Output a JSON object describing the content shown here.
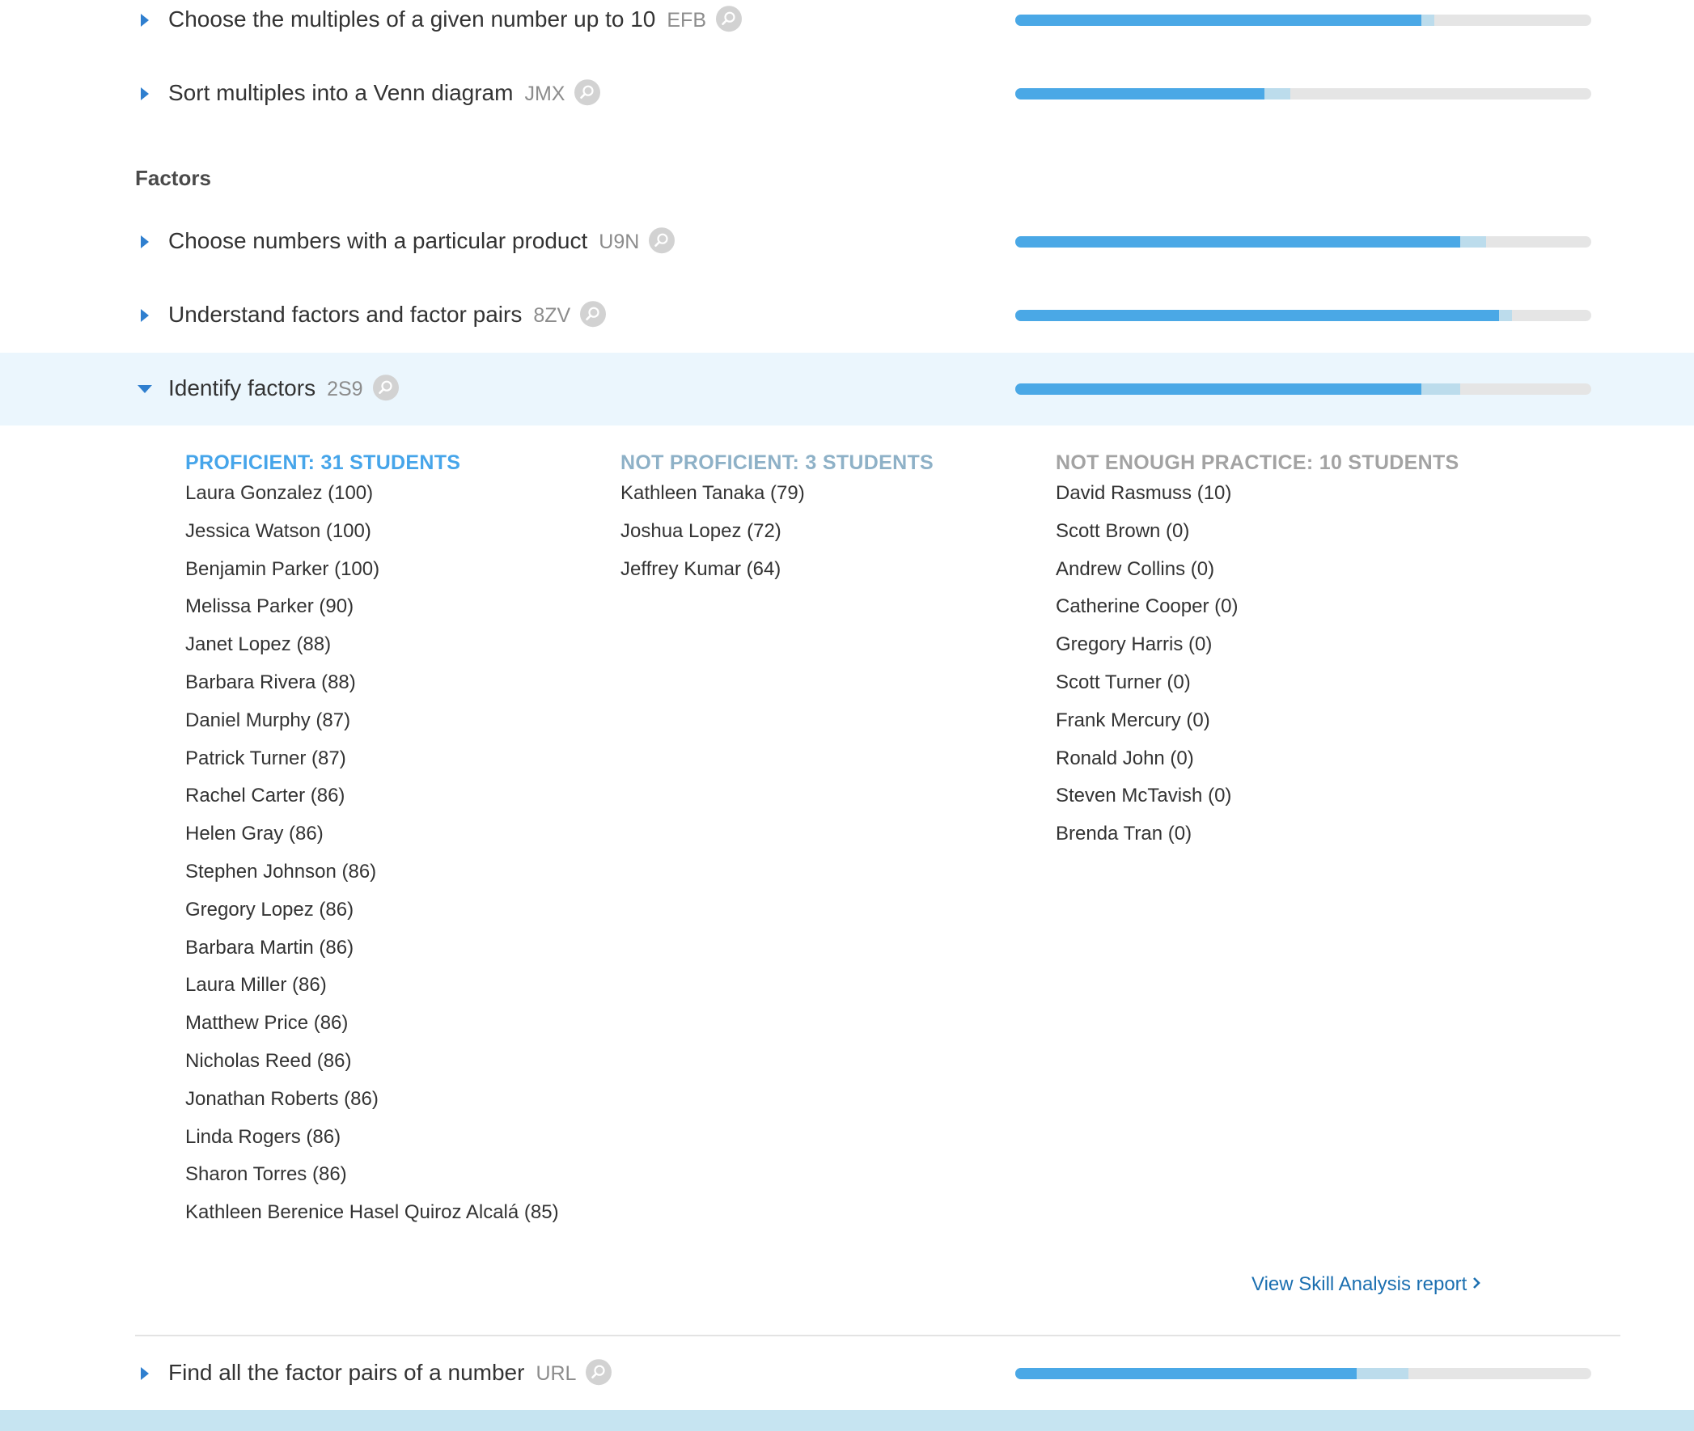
{
  "skills_top": [
    {
      "name": "Choose the multiples of a given number up to 10",
      "code": "EFB",
      "proficient_fraction": 0.705,
      "attempted_fraction": 0.728
    },
    {
      "name": "Sort multiples into a Venn diagram",
      "code": "JMX",
      "proficient_fraction": 0.433,
      "attempted_fraction": 0.478
    }
  ],
  "category": {
    "title": "Factors"
  },
  "skills_factors": [
    {
      "name": "Choose numbers with a particular product",
      "code": "U9N",
      "proficient_fraction": 0.772,
      "attempted_fraction": 0.818
    },
    {
      "name": "Understand factors and factor pairs",
      "code": "8ZV",
      "proficient_fraction": 0.84,
      "attempted_fraction": 0.862
    },
    {
      "name": "Identify factors",
      "code": "2S9",
      "proficient_fraction": 0.705,
      "attempted_fraction": 0.772,
      "expanded": true
    }
  ],
  "skill_after": {
    "name": "Find all the factor pairs of a number",
    "code": "URL",
    "proficient_fraction": 0.592,
    "attempted_fraction": 0.683
  },
  "breakdown": {
    "proficient": {
      "heading": "PROFICIENT: 31 STUDENTS",
      "students": [
        "Laura Gonzalez (100)",
        "Jessica Watson (100)",
        "Benjamin Parker (100)",
        "Melissa Parker (90)",
        "Janet Lopez (88)",
        "Barbara Rivera (88)",
        "Daniel Murphy (87)",
        "Patrick Turner (87)",
        "Rachel Carter (86)",
        "Helen Gray (86)",
        "Stephen Johnson (86)",
        "Gregory Lopez (86)",
        "Barbara Martin (86)",
        "Laura Miller (86)",
        "Matthew Price (86)",
        "Nicholas Reed (86)",
        "Jonathan Roberts (86)",
        "Linda Rogers (86)",
        "Sharon Torres (86)",
        "Kathleen Berenice Hasel Quiroz Alcalá (85)"
      ]
    },
    "not_proficient": {
      "heading": "NOT PROFICIENT: 3 STUDENTS",
      "students": [
        "Kathleen Tanaka (79)",
        "Joshua Lopez (72)",
        "Jeffrey Kumar (64)"
      ]
    },
    "not_enough_practice": {
      "heading": "NOT ENOUGH PRACTICE: 10 STUDENTS",
      "students": [
        "David Rasmuss (10)",
        "Scott Brown (0)",
        "Andrew Collins (0)",
        "Catherine Cooper (0)",
        "Gregory Harris (0)",
        "Scott Turner (0)",
        "Frank Mercury (0)",
        "Ronald John (0)",
        "Steven McTavish (0)",
        "Brenda Tran (0)"
      ]
    }
  },
  "report_link": {
    "label": "View Skill Analysis report"
  },
  "icons": {
    "collapsed": "caret-right-icon",
    "expanded": "caret-down-icon",
    "preview": "magnifier-icon",
    "link": "chevron-right-icon"
  },
  "colors": {
    "proficient_bar": "#4aa8e6",
    "attempted_bar": "#bcdcec",
    "track": "#e5e5e5",
    "expanded_row_bg": "#ebf6fd",
    "link": "#1b6fb0"
  }
}
